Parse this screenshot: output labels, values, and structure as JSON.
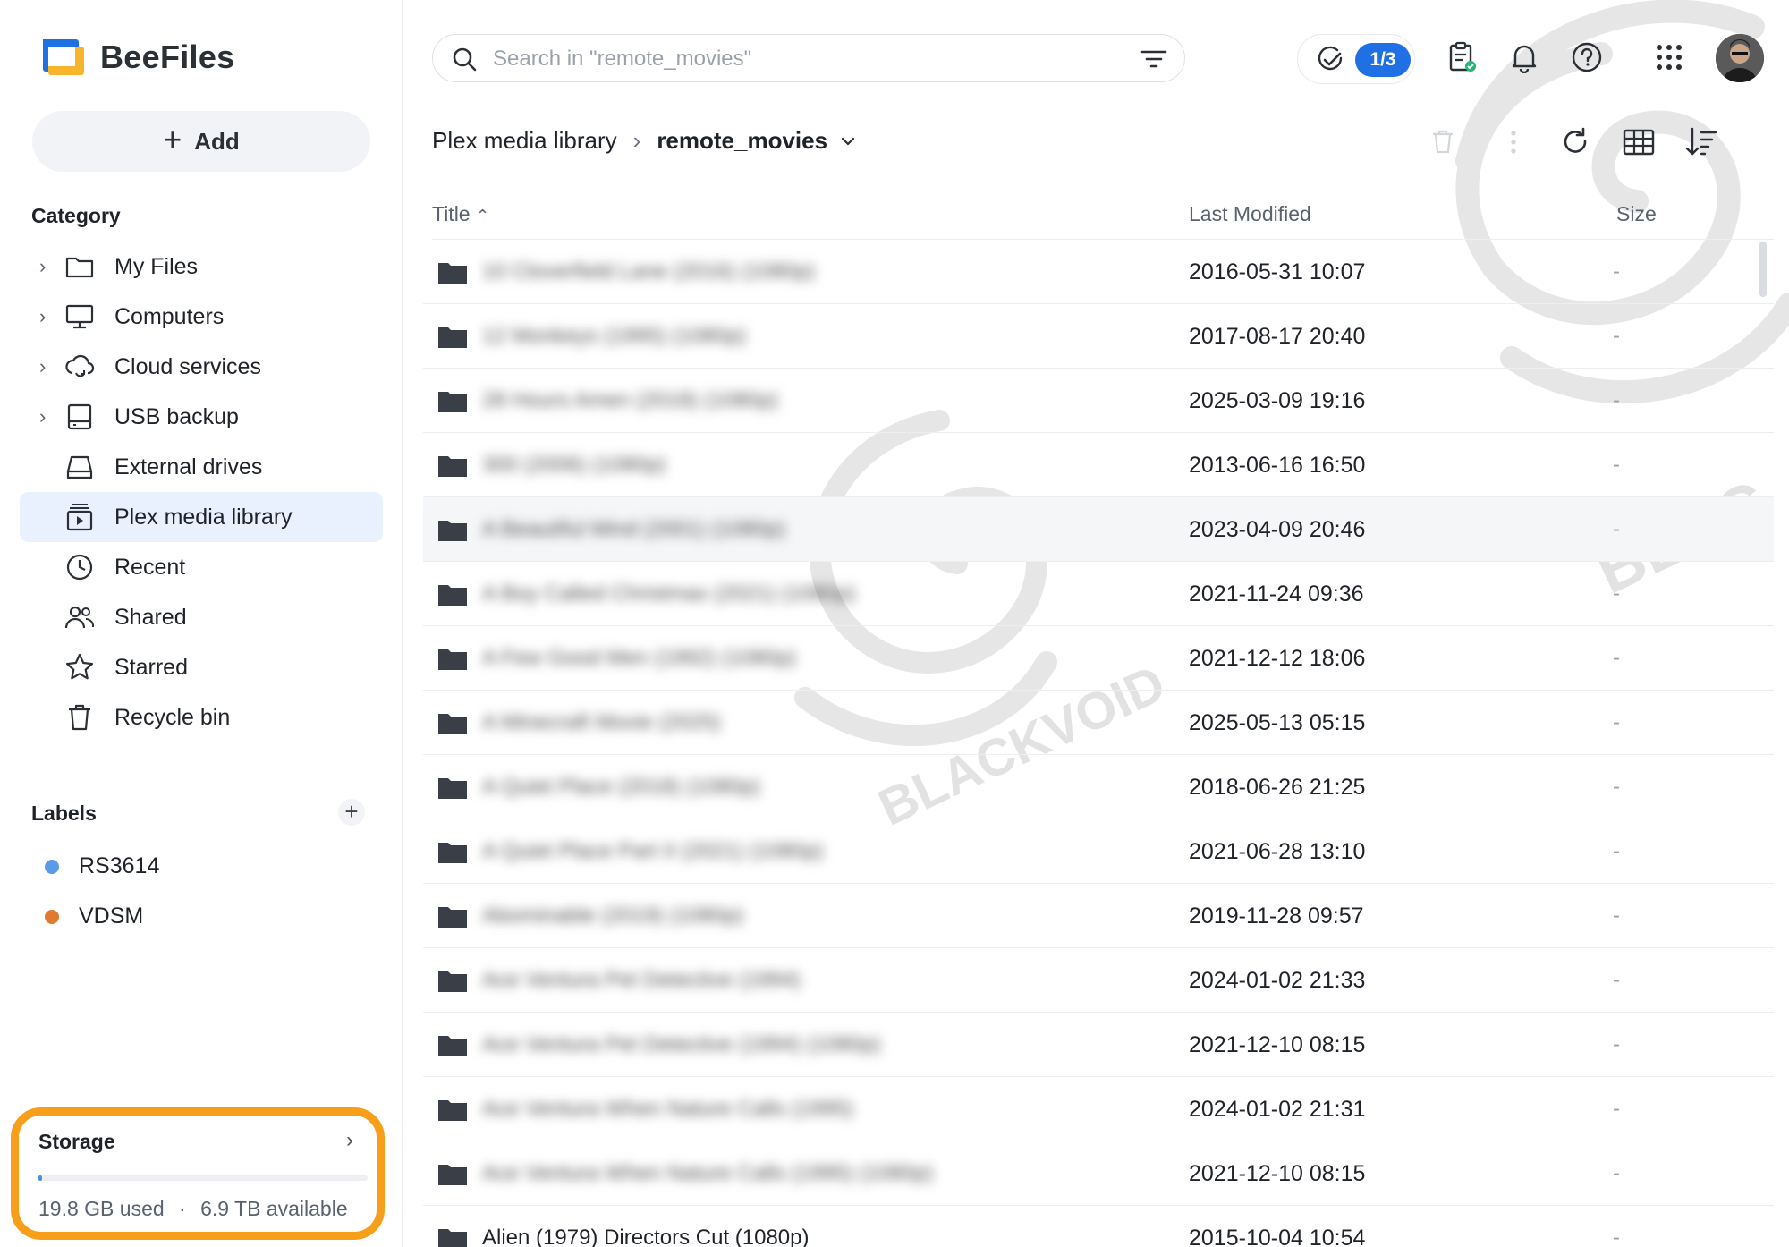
{
  "app": {
    "name": "BeeFiles"
  },
  "sidebar": {
    "add_label": "Add",
    "category_title": "Category",
    "items": [
      {
        "label": "My Files",
        "icon": "folder-icon",
        "expandable": true
      },
      {
        "label": "Computers",
        "icon": "monitor-icon",
        "expandable": true
      },
      {
        "label": "Cloud services",
        "icon": "cloud-sync-icon",
        "expandable": true
      },
      {
        "label": "USB backup",
        "icon": "usb-backup-icon",
        "expandable": true
      },
      {
        "label": "External drives",
        "icon": "external-drive-icon",
        "expandable": false
      },
      {
        "label": "Plex media library",
        "icon": "media-library-icon",
        "expandable": false,
        "active": true
      },
      {
        "label": "Recent",
        "icon": "clock-icon",
        "expandable": false
      },
      {
        "label": "Shared",
        "icon": "users-icon",
        "expandable": false
      },
      {
        "label": "Starred",
        "icon": "star-icon",
        "expandable": false
      },
      {
        "label": "Recycle bin",
        "icon": "trash-icon",
        "expandable": false
      }
    ],
    "labels_title": "Labels",
    "labels": [
      {
        "name": "RS3614",
        "color": "#5b9ae6"
      },
      {
        "name": "VDSM",
        "color": "#e07a2f"
      }
    ],
    "storage": {
      "title": "Storage",
      "used": "19.8 GB used",
      "separator": "·",
      "available": "6.9 TB available",
      "used_fraction": 0.003
    }
  },
  "search": {
    "placeholder": "Search in \"remote_movies\""
  },
  "tasks": {
    "badge": "1/3"
  },
  "breadcrumb": {
    "parent": "Plex media library",
    "current": "remote_movies"
  },
  "table": {
    "columns": {
      "title": "Title",
      "modified": "Last Modified",
      "size": "Size"
    },
    "rows": [
      {
        "title": "10 Cloverfield Lane (2016) (1080p)",
        "modified": "2016-05-31 10:07",
        "size": "-",
        "blurred": true
      },
      {
        "title": "12 Monkeys (1995) (1080p)",
        "modified": "2017-08-17 20:40",
        "size": "-",
        "blurred": true
      },
      {
        "title": "28 Hours Amen (2018) (1080p)",
        "modified": "2025-03-09 19:16",
        "size": "-",
        "blurred": true
      },
      {
        "title": "300 (2006) (1080p)",
        "modified": "2013-06-16 16:50",
        "size": "-",
        "blurred": true
      },
      {
        "title": "A Beautiful Mind (2001) (1080p)",
        "modified": "2023-04-09 20:46",
        "size": "-",
        "blurred": true,
        "highlight": true
      },
      {
        "title": "A Boy Called Christmas (2021) (1080p)",
        "modified": "2021-11-24 09:36",
        "size": "-",
        "blurred": true
      },
      {
        "title": "A Few Good Men (1992) (1080p)",
        "modified": "2021-12-12 18:06",
        "size": "-",
        "blurred": true
      },
      {
        "title": "A Minecraft Movie (2025)",
        "modified": "2025-05-13 05:15",
        "size": "-",
        "blurred": true
      },
      {
        "title": "A Quiet Place (2018) (1080p)",
        "modified": "2018-06-26 21:25",
        "size": "-",
        "blurred": true
      },
      {
        "title": "A Quiet Place Part II (2021) (1080p)",
        "modified": "2021-06-28 13:10",
        "size": "-",
        "blurred": true
      },
      {
        "title": "Abominable (2019) (1080p)",
        "modified": "2019-11-28 09:57",
        "size": "-",
        "blurred": true
      },
      {
        "title": "Ace Ventura Pet Detective (1994)",
        "modified": "2024-01-02 21:33",
        "size": "-",
        "blurred": true
      },
      {
        "title": "Ace Ventura Pet Detective (1994) (1080p)",
        "modified": "2021-12-10 08:15",
        "size": "-",
        "blurred": true
      },
      {
        "title": "Ace Ventura When Nature Calls (1995)",
        "modified": "2024-01-02 21:31",
        "size": "-",
        "blurred": true
      },
      {
        "title": "Ace Ventura When Nature Calls (1995) (1080p)",
        "modified": "2021-12-10 08:15",
        "size": "-",
        "blurred": true
      },
      {
        "title": "Alien (1979) Directors Cut (1080p)",
        "modified": "2015-10-04 10:54",
        "size": "-",
        "blurred": false
      }
    ]
  },
  "colors": {
    "accent": "#1f6fe5",
    "active_bg": "#e8f1fd",
    "storage_highlight": "#f79e1b"
  }
}
